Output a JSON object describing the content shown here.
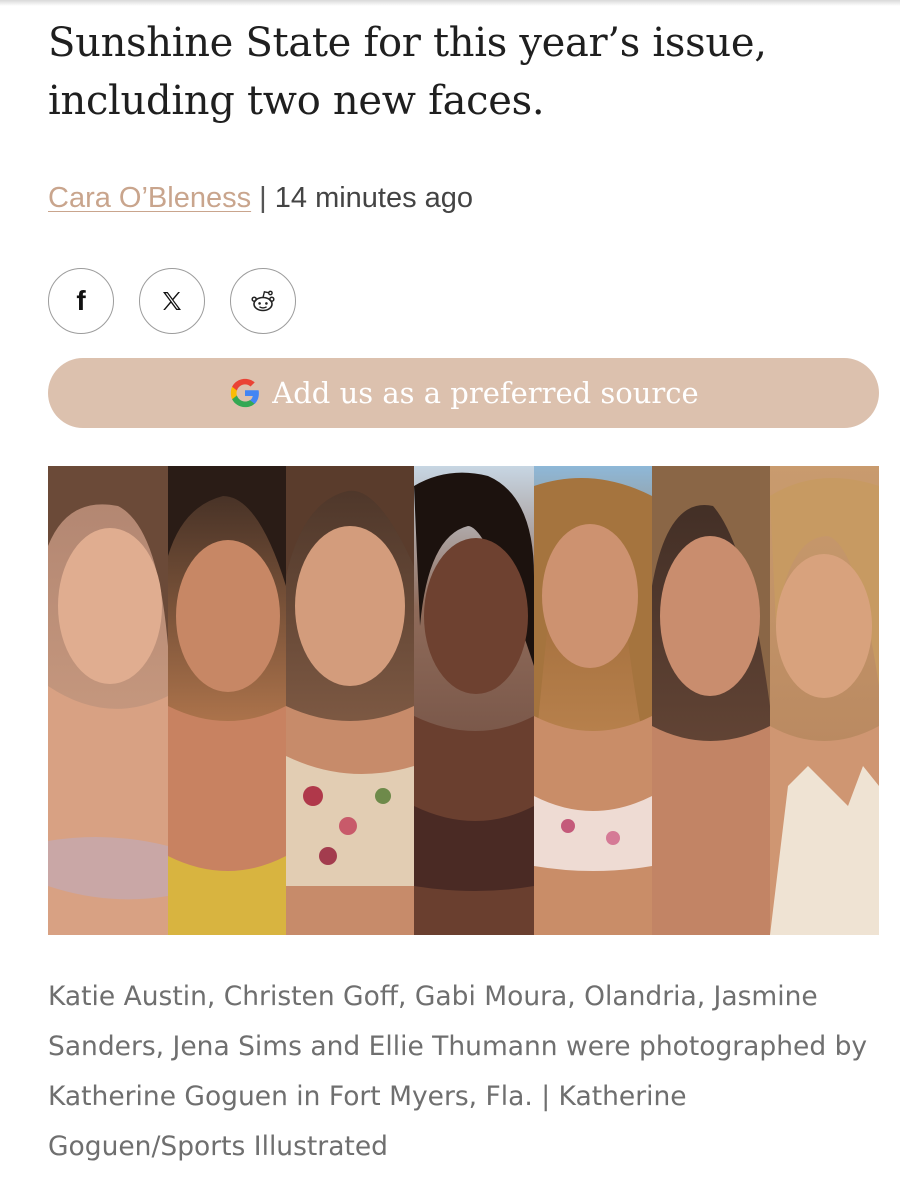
{
  "article": {
    "headline": "Sunshine State for this year’s issue, including two new faces.",
    "author": "Cara O’Bleness",
    "separator": "|",
    "timestamp": "14 minutes ago"
  },
  "share": {
    "icons": [
      "facebook-icon",
      "x-icon",
      "reddit-icon"
    ]
  },
  "preferred_source": {
    "label": "Add us as a preferred source",
    "icon": "google-icon"
  },
  "photo": {
    "models": [
      "Katie Austin",
      "Christen Goff",
      "Gabi Moura",
      "Olandria",
      "Jasmine Sanders",
      "Jena Sims",
      "Ellie Thumann"
    ]
  },
  "caption": {
    "text": "Katie Austin, Christen Goff, Gabi Moura, Olandria, Jasmine Sanders, Jena Sims and Ellie Thumann were photographed by Katherine Goguen in Fort Myers, Fla. | Katherine Goguen/Sports Illustrated"
  },
  "colors": {
    "accent": "#dcc1ae",
    "author_link": "#c9a58d",
    "caption_text": "#6f6f6f"
  }
}
